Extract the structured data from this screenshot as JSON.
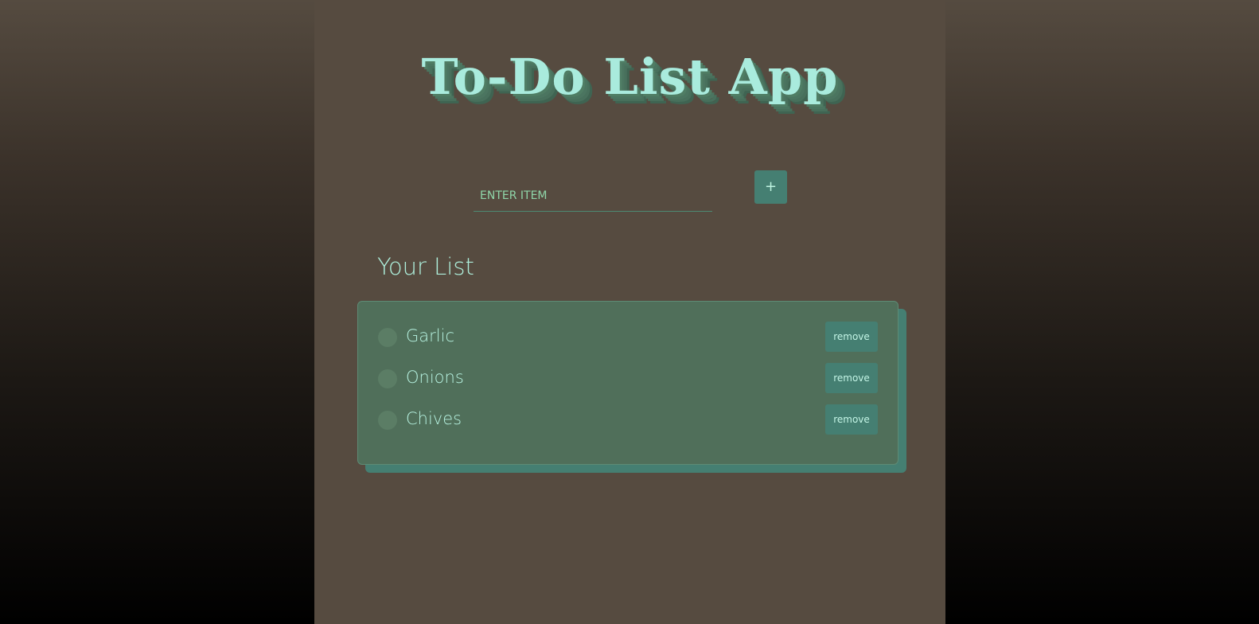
{
  "app": {
    "title": "To-Do List App"
  },
  "add_form": {
    "placeholder": "ENTER ITEM",
    "value": "",
    "add_label": "+"
  },
  "list": {
    "heading": "Your List",
    "items": [
      {
        "label": "Garlic",
        "checked": false,
        "remove_label": "remove"
      },
      {
        "label": "Onions",
        "checked": false,
        "remove_label": "remove"
      },
      {
        "label": "Chives",
        "checked": false,
        "remove_label": "remove"
      }
    ]
  },
  "colors": {
    "accent": "#457f72",
    "title_text": "#a9ebdd",
    "panel_bg": "#564b40",
    "card_bg": "#506f5a"
  }
}
